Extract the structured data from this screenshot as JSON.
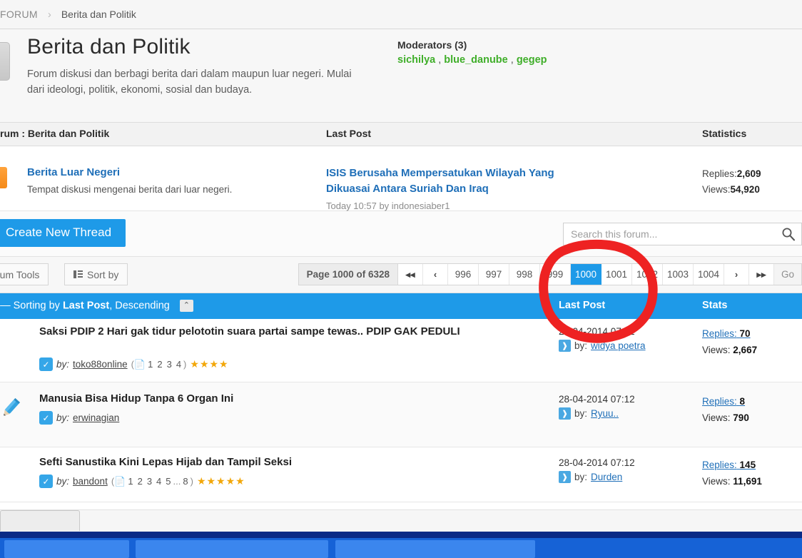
{
  "breadcrumb": {
    "home": "FORUM",
    "separator": "›",
    "current": "Berita dan Politik"
  },
  "forum_header": {
    "title": "Berita dan Politik",
    "description": "Forum diskusi dan berbagi berita dari dalam maupun luar negeri. Mulai dari ideologi, politik, ekonomi, sosial dan budaya.",
    "moderators_label": "Moderators (3)",
    "moderators": [
      "sichilya",
      "blue_danube",
      "gegep"
    ],
    "moderator_separator": " , ",
    "moderator_color": "#3fae29"
  },
  "subforum_table": {
    "headers": {
      "forum": "rum : Berita dan Politik",
      "last_post": "Last Post",
      "statistics": "Statistics"
    },
    "rows": [
      {
        "name": "Berita Luar Negeri",
        "description": "Tempat diskusi mengenai berita dari luar negeri.",
        "last_post_title": "ISIS Berusaha Mempersatukan Wilayah Yang Dikuasai Antara Suriah Dan Iraq",
        "last_post_meta": "Today 10:57 by indonesiaber1",
        "replies_label": "Replies:",
        "replies": "2,609",
        "views_label": "Views:",
        "views": "54,920"
      }
    ]
  },
  "action_bar": {
    "create_thread_label": "Create New Thread",
    "search_placeholder": "Search this forum...",
    "search_value": ""
  },
  "tools_bar": {
    "forum_tools_label": "rum Tools",
    "sort_by_label": "Sort by",
    "page_label": "Page 1000 of 6328",
    "first_arrow": "◀◀",
    "prev_arrow": "‹",
    "next_arrow": "›",
    "last_arrow": "▶▶",
    "pages": [
      "996",
      "997",
      "998",
      "999",
      "1000",
      "1001",
      "1002",
      "1003",
      "1004"
    ],
    "active_page": "1000",
    "go_label": "Go"
  },
  "thread_header": {
    "left_prefix": "d — Sorting by ",
    "sort_field": "Last Post",
    "left_suffix": ", Descending",
    "sort_toggle": "⌃",
    "last_post": "Last Post",
    "stats": "Stats",
    "bar_color": "#1e9ae8"
  },
  "threads": [
    {
      "title": "Saksi PDIP 2 Hari gak tidur pelototin suara partai sampe tewas.. PDIP GAK PEDULI",
      "by_label": "by:",
      "author": "toko88online",
      "pages": [
        "1",
        "2",
        "3",
        "4"
      ],
      "page_ellipsis": false,
      "stars": 4,
      "last_post_date": "28-04-2014 07:52",
      "last_post_by_label": "by:",
      "last_post_author": "widya poetra",
      "replies_label": "Replies:",
      "replies": "70",
      "views_label": "Views:",
      "views": "2,667",
      "status_icon": "checkbox-blue"
    },
    {
      "title": "Manusia Bisa Hidup Tanpa 6 Organ Ini",
      "by_label": "by:",
      "author": "erwinagian",
      "pages": [],
      "page_ellipsis": false,
      "stars": 0,
      "last_post_date": "28-04-2014 07:12",
      "last_post_by_label": "by:",
      "last_post_author": "Ryuu..",
      "replies_label": "Replies:",
      "replies": "8",
      "views_label": "Views:",
      "views": "790",
      "status_icon": "pencil-blue"
    },
    {
      "title": "Sefti Sanustika Kini Lepas Hijab dan Tampil Seksi",
      "by_label": "by:",
      "author": "bandont",
      "pages": [
        "1",
        "2",
        "3",
        "4",
        "5",
        "...",
        "8"
      ],
      "page_ellipsis": true,
      "stars": 5,
      "last_post_date": "28-04-2014 07:12",
      "last_post_by_label": "by:",
      "last_post_author": "Durden",
      "replies_label": "Replies:",
      "replies": "145",
      "views_label": "Views:",
      "views": "11,691",
      "status_icon": "checkbox-blue"
    }
  ],
  "annotation": {
    "shape": "hand-drawn-circle",
    "color": "#ee2222"
  }
}
